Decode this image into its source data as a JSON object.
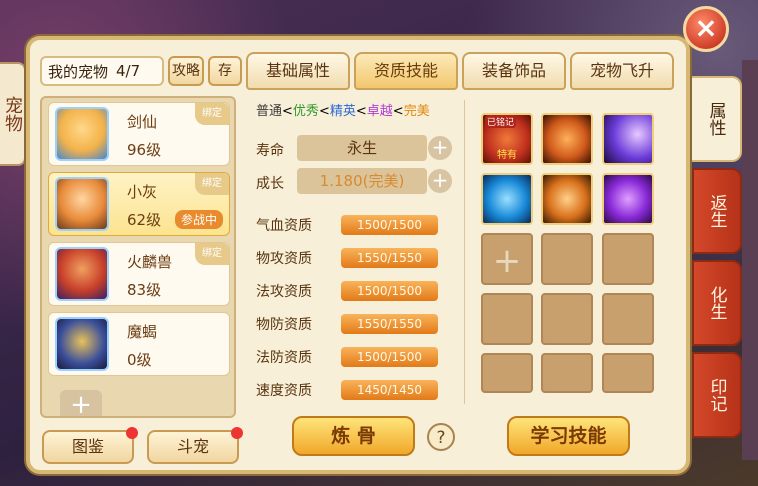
{
  "left_edge_label": "宠物",
  "close_label": "×",
  "pet_list": {
    "title": "我的宠物",
    "count": "4/7",
    "guide_button": "攻略",
    "store_button": "存",
    "items": [
      {
        "name": "剑仙",
        "level": "96级",
        "tag": "绑定",
        "avatar_color": "#f3b24a"
      },
      {
        "name": "小灰",
        "level": "62级",
        "tag": "绑定",
        "status": "参战中",
        "avatar_color": "#e88a3a"
      },
      {
        "name": "火麟兽",
        "level": "83级",
        "tag": "绑定",
        "avatar_color": "#c8402a"
      },
      {
        "name": "魔蝎",
        "level": "0级",
        "avatar_color": "#3a4e9a"
      }
    ],
    "add_icon": "plus-icon"
  },
  "tabs": [
    "基础属性",
    "资质技能",
    "装备饰品",
    "宠物飞升"
  ],
  "active_tab": 1,
  "quality": {
    "t1": "普通",
    "t2": "优秀",
    "t3": "精英",
    "t4": "卓越",
    "t5": "完美",
    "sep": "<",
    "colors": {
      "t1": "#3a3a3a",
      "t2": "#2e9a2e",
      "t3": "#2a6ad8",
      "t4": "#b03ad8",
      "t5": "#e08a10"
    }
  },
  "lifespan": {
    "label": "寿命",
    "value": "永生"
  },
  "growth": {
    "label": "成长",
    "value": "1.180(完美)"
  },
  "aptitudes": [
    {
      "label": "气血资质",
      "value": "1500/1500"
    },
    {
      "label": "物攻资质",
      "value": "1550/1550"
    },
    {
      "label": "法攻资质",
      "value": "1500/1500"
    },
    {
      "label": "物防资质",
      "value": "1550/1550"
    },
    {
      "label": "法防资质",
      "value": "1500/1500"
    },
    {
      "label": "速度资质",
      "value": "1450/1450"
    }
  ],
  "skills": [
    {
      "name": "skill-1",
      "badge": "已铭记",
      "caption": "特有",
      "color": "#c0301e"
    },
    {
      "name": "skill-2",
      "color": "#d05a1a"
    },
    {
      "name": "skill-3",
      "color": "#6a3ad8"
    },
    {
      "name": "skill-4",
      "color": "#1a8ad8"
    },
    {
      "name": "skill-5",
      "color": "#d8701a"
    },
    {
      "name": "skill-6",
      "color": "#8a2ad8"
    }
  ],
  "buttons": {
    "refine_bone": "炼 骨",
    "help": "?",
    "learn_skill": "学习技能",
    "handbook": "图鉴",
    "pet_battle": "斗宠"
  },
  "side_tabs": [
    "属性",
    "返生",
    "化生",
    "印记"
  ]
}
